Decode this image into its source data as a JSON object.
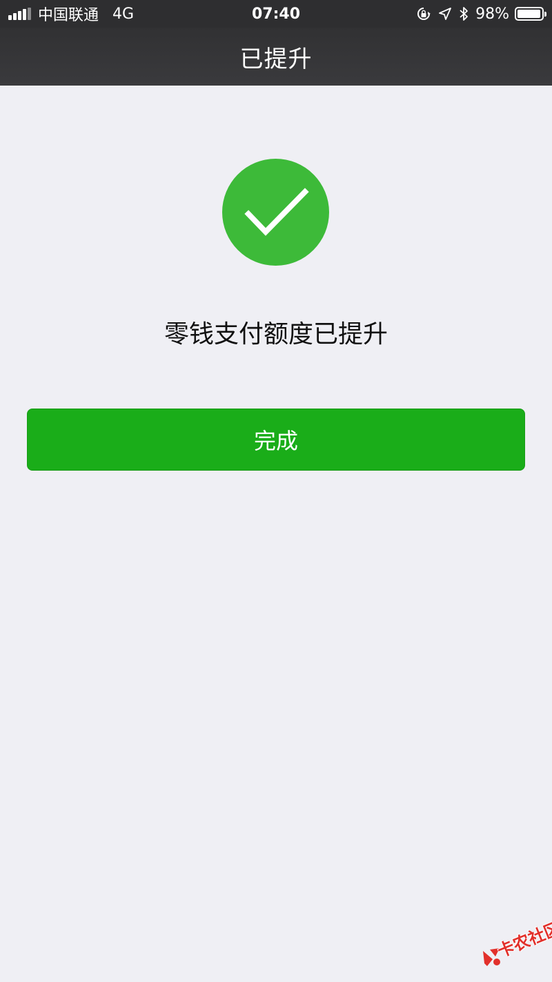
{
  "status_bar": {
    "carrier": "中国联通",
    "network": "4G",
    "time": "07:40",
    "battery_percent": "98%",
    "battery_level": 0.98
  },
  "nav": {
    "title": "已提升"
  },
  "result": {
    "message": "零钱支付额度已提升"
  },
  "actions": {
    "done_label": "完成"
  },
  "watermark": {
    "text": "卡农社区"
  },
  "colors": {
    "success_green": "#3dba39",
    "button_green": "#1aad19",
    "watermark_red": "#e2302b",
    "background": "#efeff4",
    "nav_bg": "#333335"
  },
  "icons": {
    "status": [
      "signal-icon",
      "rotation-lock-icon",
      "location-arrow-icon",
      "bluetooth-icon",
      "battery-icon"
    ],
    "result": "checkmark-icon"
  }
}
